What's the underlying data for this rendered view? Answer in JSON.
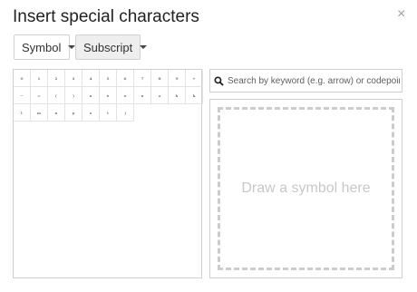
{
  "dialog": {
    "title": "Insert special characters",
    "close_glyph": "×"
  },
  "filters": {
    "category": "Symbol",
    "subcategory": "Subscript"
  },
  "characters": [
    "₀",
    "₁",
    "₂",
    "₃",
    "₄",
    "₅",
    "₆",
    "₇",
    "₈",
    "₉",
    "₊",
    "₋",
    "₌",
    "₍",
    "₎",
    "ₐ",
    "ₑ",
    "ₒ",
    "ₓ",
    "ₔ",
    "ₕ",
    "ₖ",
    "ₗ",
    "ₘ",
    "ₙ",
    "ₚ",
    "ₛ",
    "ₜ",
    "ⱼ"
  ],
  "search": {
    "placeholder": "Search by keyword (e.g. arrow) or codepoint",
    "icon": "search-icon"
  },
  "draw": {
    "hint": "Draw a symbol here"
  },
  "colors": {
    "accent_border": "#cfcfcf",
    "hint_text": "#c8c8c8"
  }
}
